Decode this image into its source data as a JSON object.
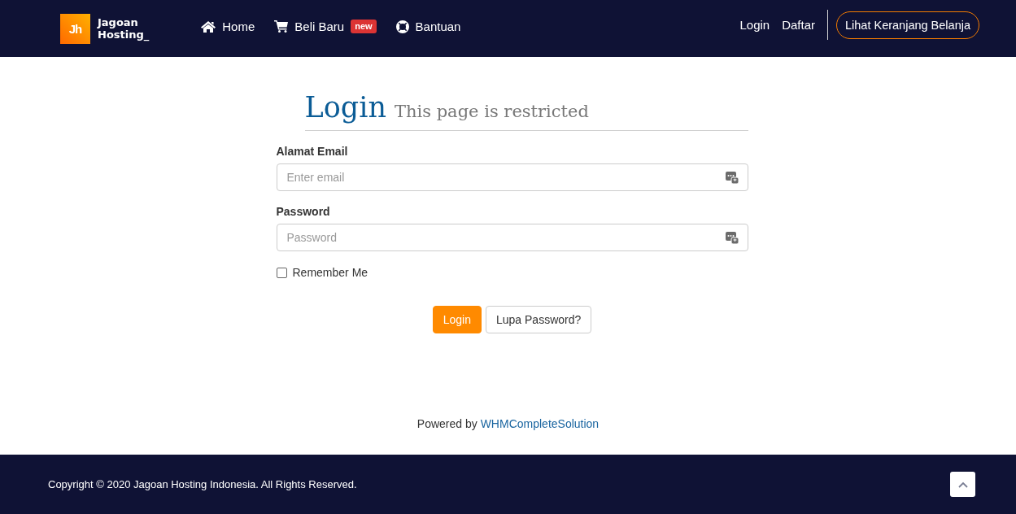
{
  "header": {
    "logo": {
      "mark": "Jh",
      "lines": [
        "Jagoan",
        "Hosting_"
      ]
    },
    "nav": [
      {
        "kind": "home",
        "label": "Home"
      },
      {
        "kind": "cart",
        "label": "Beli Baru",
        "badge": "new"
      },
      {
        "kind": "support",
        "label": "Bantuan"
      }
    ],
    "account_links": [
      {
        "label": "Login"
      },
      {
        "label": "Daftar"
      }
    ],
    "cart_button": "Lihat Keranjang Belanja"
  },
  "login": {
    "title": "Login",
    "subtitle": "This page is restricted",
    "fields": [
      {
        "label": "Alamat Email",
        "placeholder": "Enter email"
      },
      {
        "label": "Password",
        "placeholder": "Password"
      }
    ],
    "remember": {
      "label": "Remember Me",
      "checked": false
    },
    "buttons": [
      {
        "kind": "primary",
        "label": "Login"
      },
      {
        "kind": "default",
        "label": "Lupa Password?"
      }
    ]
  },
  "powered_by": {
    "text": "Powered by",
    "link": "WHMCompleteSolution"
  },
  "footer": {
    "copyright": "Copyright © 2020 Jagoan Hosting Indonesia. All Rights Reserved."
  }
}
